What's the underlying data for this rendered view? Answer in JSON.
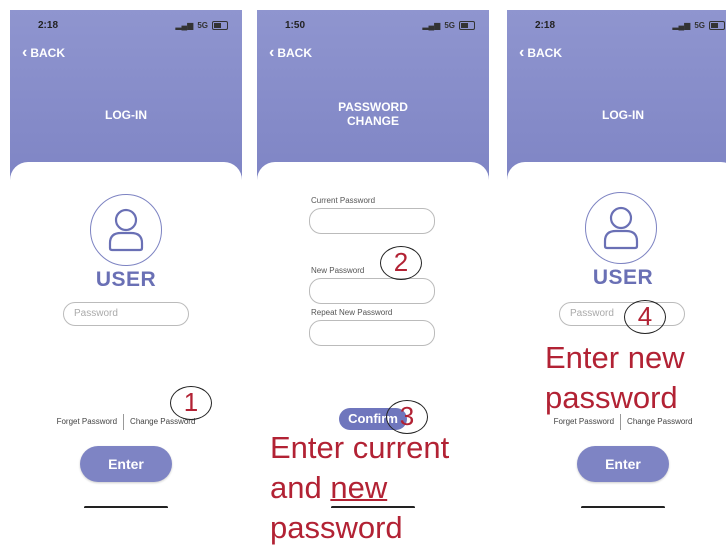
{
  "screens": [
    {
      "status_time": "2:18",
      "signal": "5G",
      "back_label": "BACK",
      "title": "LOG-IN",
      "user_label": "USER",
      "password_placeholder": "Password",
      "forgot_label": "Forget Password",
      "change_label": "Change Password",
      "enter_label": "Enter"
    },
    {
      "status_time": "1:50",
      "signal": "5G",
      "back_label": "BACK",
      "title_line1": "PASSWORD",
      "title_line2": "CHANGE",
      "current_label": "Current Password",
      "new_label": "New Password",
      "repeat_label": "Repeat New Password",
      "confirm_label": "Confirm"
    },
    {
      "status_time": "2:18",
      "signal": "5G",
      "back_label": "BACK",
      "title": "LOG-IN",
      "user_label": "USER",
      "password_placeholder": "Password",
      "forgot_label": "Forget Password",
      "change_label": "Change Password",
      "enter_label": "Enter"
    }
  ],
  "steps": [
    "1",
    "2",
    "3",
    "4"
  ],
  "annotations": {
    "step3_line1": "Enter current",
    "step3_line2a": "and ",
    "step3_line2b": "new ",
    "step3_line3": "password",
    "step4_line1": "Enter new",
    "step4_line2": "password"
  },
  "colors": {
    "header": "#7e84c4",
    "accent": "#6a70b5",
    "annotation": "#b22234"
  }
}
